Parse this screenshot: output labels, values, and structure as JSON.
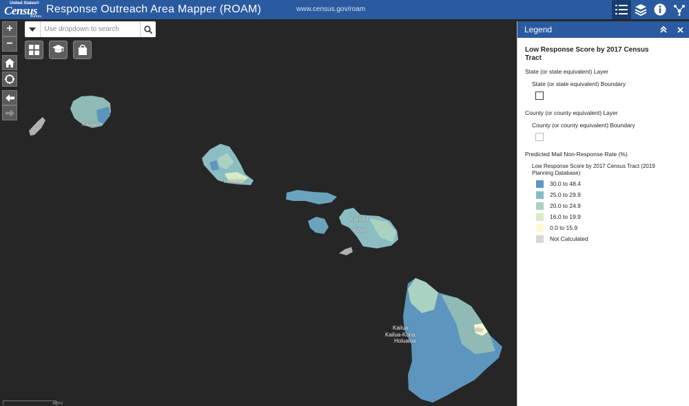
{
  "header": {
    "logo": {
      "top": "United States®",
      "main": "Census",
      "bottom": "Bureau"
    },
    "title": "Response Outreach Area Mapper (ROAM)",
    "url": "www.census.gov/roam",
    "icons": [
      "legend-list-icon",
      "layers-icon",
      "info-icon",
      "share-icon"
    ]
  },
  "toolbar": {
    "zoom_in": "+",
    "zoom_out": "−",
    "search_placeholder": "Use dropdown to search"
  },
  "map": {
    "labels": {
      "kapaa": "Kapaa",
      "honolulu": "Honolulu",
      "kahului": "Kahului",
      "kihei": "Kihei",
      "kailua": "Kailua",
      "kailua_kona": "Kailua-Kona",
      "holualoa": "Holualoa",
      "hilo": "Hilo"
    },
    "scale_label": "40mi"
  },
  "legend": {
    "header": "Legend",
    "title": "Low Response Score by 2017 Census Tract",
    "layer1": "State (or state equivalent) Layer",
    "layer1_item": "State (or state equivalent) Boundary",
    "layer2": "County (or county equivalent) Layer",
    "layer2_item": "County (or county equivalent) Boundary",
    "layer3": "Predicted Mail Non-Response Rate (%)",
    "layer3_sub": "Low Response Score by 2017 Census Tract (2019 Planning Database)",
    "classes": [
      {
        "label": "30.0 to 48.4",
        "color": "#5c95bd"
      },
      {
        "label": "25.0 to 29.9",
        "color": "#86bcc8"
      },
      {
        "label": "20.0 to 24.9",
        "color": "#a9d3c0"
      },
      {
        "label": "16.0 to 19.9",
        "color": "#d7ebc6"
      },
      {
        "label": "0.0 to 15.9",
        "color": "#fbfad2"
      },
      {
        "label": "Not Calculated",
        "color": "#d6d6d6"
      }
    ]
  }
}
